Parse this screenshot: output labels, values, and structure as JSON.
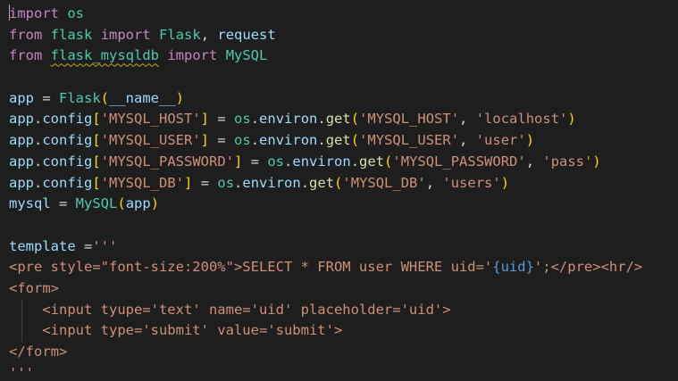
{
  "editor": {
    "lines": [
      {
        "tokens": [
          {
            "t": "import",
            "c": "kw"
          },
          {
            "t": " ",
            "c": "op"
          },
          {
            "t": "os",
            "c": "mod"
          }
        ]
      },
      {
        "tokens": [
          {
            "t": "from",
            "c": "kw"
          },
          {
            "t": " ",
            "c": "op"
          },
          {
            "t": "flask",
            "c": "mod"
          },
          {
            "t": " ",
            "c": "op"
          },
          {
            "t": "import",
            "c": "kw"
          },
          {
            "t": " ",
            "c": "op"
          },
          {
            "t": "Flask",
            "c": "mod"
          },
          {
            "t": ", ",
            "c": "op"
          },
          {
            "t": "request",
            "c": "var"
          }
        ]
      },
      {
        "tokens": [
          {
            "t": "from",
            "c": "kw"
          },
          {
            "t": " ",
            "c": "op"
          },
          {
            "t": "flask_mysqldb",
            "c": "mod squiggle"
          },
          {
            "t": " ",
            "c": "op"
          },
          {
            "t": "import",
            "c": "kw"
          },
          {
            "t": " ",
            "c": "op"
          },
          {
            "t": "MySQL",
            "c": "mod"
          }
        ]
      },
      {
        "tokens": []
      },
      {
        "tokens": [
          {
            "t": "app",
            "c": "var"
          },
          {
            "t": " = ",
            "c": "op"
          },
          {
            "t": "Flask",
            "c": "mod"
          },
          {
            "t": "(",
            "c": "br1"
          },
          {
            "t": "__name__",
            "c": "dunder"
          },
          {
            "t": ")",
            "c": "br1"
          }
        ]
      },
      {
        "tokens": [
          {
            "t": "app",
            "c": "var"
          },
          {
            "t": ".",
            "c": "op"
          },
          {
            "t": "config",
            "c": "var"
          },
          {
            "t": "[",
            "c": "br1"
          },
          {
            "t": "'MYSQL_HOST'",
            "c": "str"
          },
          {
            "t": "]",
            "c": "br1"
          },
          {
            "t": " = ",
            "c": "op"
          },
          {
            "t": "os",
            "c": "mod"
          },
          {
            "t": ".",
            "c": "op"
          },
          {
            "t": "environ",
            "c": "var"
          },
          {
            "t": ".",
            "c": "op"
          },
          {
            "t": "get",
            "c": "fn"
          },
          {
            "t": "(",
            "c": "br1"
          },
          {
            "t": "'MYSQL_HOST'",
            "c": "str"
          },
          {
            "t": ", ",
            "c": "op"
          },
          {
            "t": "'localhost'",
            "c": "str"
          },
          {
            "t": ")",
            "c": "br1"
          }
        ]
      },
      {
        "tokens": [
          {
            "t": "app",
            "c": "var"
          },
          {
            "t": ".",
            "c": "op"
          },
          {
            "t": "config",
            "c": "var"
          },
          {
            "t": "[",
            "c": "br1"
          },
          {
            "t": "'MYSQL_USER'",
            "c": "str"
          },
          {
            "t": "]",
            "c": "br1"
          },
          {
            "t": " = ",
            "c": "op"
          },
          {
            "t": "os",
            "c": "mod"
          },
          {
            "t": ".",
            "c": "op"
          },
          {
            "t": "environ",
            "c": "var"
          },
          {
            "t": ".",
            "c": "op"
          },
          {
            "t": "get",
            "c": "fn"
          },
          {
            "t": "(",
            "c": "br1"
          },
          {
            "t": "'MYSQL_USER'",
            "c": "str"
          },
          {
            "t": ", ",
            "c": "op"
          },
          {
            "t": "'user'",
            "c": "str"
          },
          {
            "t": ")",
            "c": "br1"
          }
        ]
      },
      {
        "tokens": [
          {
            "t": "app",
            "c": "var"
          },
          {
            "t": ".",
            "c": "op"
          },
          {
            "t": "config",
            "c": "var"
          },
          {
            "t": "[",
            "c": "br1"
          },
          {
            "t": "'MYSQL_PASSWORD'",
            "c": "str"
          },
          {
            "t": "]",
            "c": "br1"
          },
          {
            "t": " = ",
            "c": "op"
          },
          {
            "t": "os",
            "c": "mod"
          },
          {
            "t": ".",
            "c": "op"
          },
          {
            "t": "environ",
            "c": "var"
          },
          {
            "t": ".",
            "c": "op"
          },
          {
            "t": "get",
            "c": "fn"
          },
          {
            "t": "(",
            "c": "br1"
          },
          {
            "t": "'MYSQL_PASSWORD'",
            "c": "str"
          },
          {
            "t": ", ",
            "c": "op"
          },
          {
            "t": "'pass'",
            "c": "str"
          },
          {
            "t": ")",
            "c": "br1"
          }
        ]
      },
      {
        "tokens": [
          {
            "t": "app",
            "c": "var"
          },
          {
            "t": ".",
            "c": "op"
          },
          {
            "t": "config",
            "c": "var"
          },
          {
            "t": "[",
            "c": "br1"
          },
          {
            "t": "'MYSQL_DB'",
            "c": "str"
          },
          {
            "t": "]",
            "c": "br1"
          },
          {
            "t": " = ",
            "c": "op"
          },
          {
            "t": "os",
            "c": "mod"
          },
          {
            "t": ".",
            "c": "op"
          },
          {
            "t": "environ",
            "c": "var"
          },
          {
            "t": ".",
            "c": "op"
          },
          {
            "t": "get",
            "c": "fn"
          },
          {
            "t": "(",
            "c": "br1"
          },
          {
            "t": "'MYSQL_DB'",
            "c": "str"
          },
          {
            "t": ", ",
            "c": "op"
          },
          {
            "t": "'users'",
            "c": "str"
          },
          {
            "t": ")",
            "c": "br1"
          }
        ]
      },
      {
        "tokens": [
          {
            "t": "mysql",
            "c": "var"
          },
          {
            "t": " = ",
            "c": "op"
          },
          {
            "t": "MySQL",
            "c": "mod"
          },
          {
            "t": "(",
            "c": "br1"
          },
          {
            "t": "app",
            "c": "var"
          },
          {
            "t": ")",
            "c": "br1"
          }
        ]
      },
      {
        "tokens": []
      },
      {
        "tokens": [
          {
            "t": "template",
            "c": "var"
          },
          {
            "t": " =",
            "c": "op"
          },
          {
            "t": "'''",
            "c": "str"
          }
        ]
      },
      {
        "tokens": [
          {
            "t": "<pre style=\"font-size:200%\">SELECT * FROM user WHERE uid='",
            "c": "str"
          },
          {
            "t": "{uid}",
            "c": "interp"
          },
          {
            "t": "';</pre><hr/>",
            "c": "str"
          }
        ]
      },
      {
        "tokens": [
          {
            "t": "<form>",
            "c": "str"
          }
        ]
      },
      {
        "tokens": [
          {
            "t": "    <input tyupe='text' name='uid' placeholder='uid'>",
            "c": "str"
          }
        ],
        "indent": true
      },
      {
        "tokens": [
          {
            "t": "    <input type='submit' value='submit'>",
            "c": "str"
          }
        ],
        "indent": true
      },
      {
        "tokens": [
          {
            "t": "</form>",
            "c": "str"
          }
        ]
      },
      {
        "tokens": [
          {
            "t": "'''",
            "c": "str"
          }
        ]
      }
    ]
  },
  "colors": {
    "background": "#1e1e1e",
    "keyword": "#c586c0",
    "module": "#4ec9b0",
    "variable": "#9cdcfe",
    "function": "#dcdcaa",
    "string": "#ce9178",
    "bracket": "#ffd700",
    "interpolation": "#569cd6"
  }
}
